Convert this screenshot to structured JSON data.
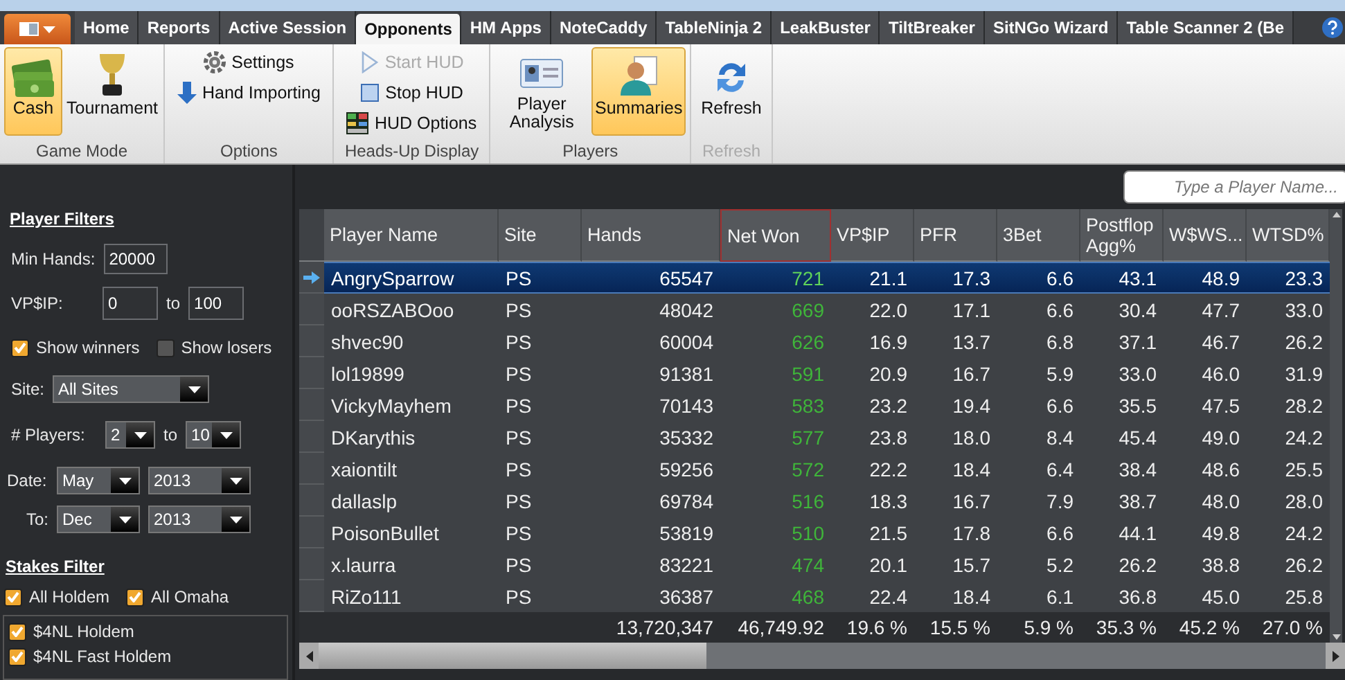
{
  "tabs": [
    {
      "label": "Home",
      "selected": false
    },
    {
      "label": "Reports",
      "selected": false
    },
    {
      "label": "Active Session",
      "selected": false
    },
    {
      "label": "Opponents",
      "selected": true
    },
    {
      "label": "HM Apps",
      "selected": false
    },
    {
      "label": "NoteCaddy",
      "selected": false
    },
    {
      "label": "TableNinja 2",
      "selected": false
    },
    {
      "label": "LeakBuster",
      "selected": false
    },
    {
      "label": "TiltBreaker",
      "selected": false
    },
    {
      "label": "SitNGo Wizard",
      "selected": false
    },
    {
      "label": "Table Scanner 2 (Be",
      "selected": false
    }
  ],
  "ribbon": {
    "groups": [
      {
        "label": "Game Mode",
        "disabled": false,
        "items": [
          {
            "kind": "large",
            "label": "Cash",
            "selected": true
          },
          {
            "kind": "large",
            "label": "Tournament",
            "selected": false
          }
        ]
      },
      {
        "label": "Options",
        "disabled": false,
        "items": [
          {
            "kind": "small",
            "label": "Settings",
            "disabled": false
          },
          {
            "kind": "small",
            "label": "Hand Importing",
            "disabled": false
          }
        ]
      },
      {
        "label": "Heads-Up Display",
        "disabled": false,
        "items": [
          {
            "kind": "small",
            "label": "Start HUD",
            "disabled": true
          },
          {
            "kind": "small",
            "label": "Stop HUD",
            "disabled": false
          },
          {
            "kind": "small",
            "label": "HUD Options",
            "disabled": false
          }
        ]
      },
      {
        "label": "Players",
        "disabled": false,
        "items": [
          {
            "kind": "large",
            "label": "Player Analysis",
            "selected": false
          },
          {
            "kind": "large",
            "label": "Summaries",
            "selected": true
          }
        ]
      },
      {
        "label": "Refresh",
        "disabled": true,
        "items": [
          {
            "kind": "large",
            "label": "Refresh",
            "selected": false
          }
        ]
      }
    ]
  },
  "filters": {
    "title": "Player Filters",
    "min_hands": {
      "label": "Min Hands:",
      "value": "20000"
    },
    "vpip": {
      "label": "VP$IP:",
      "from": "0",
      "to_label": "to",
      "to": "100"
    },
    "show_winners": {
      "label": "Show winners",
      "checked": true
    },
    "show_losers": {
      "label": "Show losers",
      "checked": false
    },
    "site": {
      "label": "Site:",
      "value": "All Sites"
    },
    "players": {
      "label": "# Players:",
      "from": "2",
      "to_label": "to",
      "to": "10"
    },
    "date": {
      "label": "Date:",
      "month": "May",
      "year": "2013"
    },
    "date_to": {
      "label": "To:",
      "month": "Dec",
      "year": "2013"
    }
  },
  "stakes": {
    "title": "Stakes Filter",
    "all_holdem": {
      "label": "All Holdem",
      "checked": true
    },
    "all_omaha": {
      "label": "All Omaha",
      "checked": true
    },
    "items": [
      {
        "label": "$4NL Holdem",
        "checked": true
      },
      {
        "label": "$4NL Fast Holdem",
        "checked": true
      }
    ]
  },
  "search": {
    "placeholder": "Type a Player Name..."
  },
  "table": {
    "columns": [
      {
        "label": "Player Name",
        "kind": "text",
        "sorted": false
      },
      {
        "label": "Site",
        "kind": "text",
        "sorted": false
      },
      {
        "label": "Hands",
        "kind": "number",
        "sorted": false
      },
      {
        "label": "Net Won",
        "kind": "money",
        "sorted": true
      },
      {
        "label": "VP$IP",
        "kind": "number",
        "sorted": false
      },
      {
        "label": "PFR",
        "kind": "number",
        "sorted": false
      },
      {
        "label": "3Bet",
        "kind": "number",
        "sorted": false
      },
      {
        "label": "Postflop Agg%",
        "kind": "number",
        "sorted": false
      },
      {
        "label": "W$WS...",
        "kind": "number",
        "sorted": false
      },
      {
        "label": "WTSD%",
        "kind": "number",
        "sorted": false
      }
    ],
    "rows": [
      {
        "selected": true,
        "cells": [
          "AngrySparrow",
          "PS",
          "65547",
          "721",
          "21.1",
          "17.3",
          "6.6",
          "43.1",
          "48.9",
          "23.3"
        ]
      },
      {
        "selected": false,
        "cells": [
          "ooRSZABOoo",
          "PS",
          "48042",
          "669",
          "22.0",
          "17.1",
          "6.6",
          "30.4",
          "47.7",
          "33.0"
        ]
      },
      {
        "selected": false,
        "cells": [
          "shvec90",
          "PS",
          "60004",
          "626",
          "16.9",
          "13.7",
          "6.8",
          "37.1",
          "46.7",
          "26.2"
        ]
      },
      {
        "selected": false,
        "cells": [
          "lol19899",
          "PS",
          "91381",
          "591",
          "20.9",
          "16.7",
          "5.9",
          "33.0",
          "46.0",
          "31.9"
        ]
      },
      {
        "selected": false,
        "cells": [
          "VickyMayhem",
          "PS",
          "70143",
          "583",
          "23.2",
          "19.4",
          "6.6",
          "35.5",
          "47.5",
          "28.2"
        ]
      },
      {
        "selected": false,
        "cells": [
          "DKarythis",
          "PS",
          "35332",
          "577",
          "23.8",
          "18.0",
          "8.4",
          "45.4",
          "49.0",
          "24.2"
        ]
      },
      {
        "selected": false,
        "cells": [
          "xaiontilt",
          "PS",
          "59256",
          "572",
          "22.2",
          "18.4",
          "6.4",
          "38.4",
          "48.6",
          "25.5"
        ]
      },
      {
        "selected": false,
        "cells": [
          "dallaslp",
          "PS",
          "69784",
          "516",
          "18.3",
          "16.7",
          "7.9",
          "38.7",
          "48.0",
          "28.0"
        ]
      },
      {
        "selected": false,
        "cells": [
          "PoisonBullet",
          "PS",
          "53819",
          "510",
          "21.5",
          "17.8",
          "6.6",
          "44.1",
          "49.8",
          "24.2"
        ]
      },
      {
        "selected": false,
        "cells": [
          "x.laurra",
          "PS",
          "83221",
          "474",
          "20.1",
          "15.7",
          "5.2",
          "26.2",
          "38.8",
          "26.2"
        ]
      },
      {
        "selected": false,
        "cells": [
          "RiZo111",
          "PS",
          "36387",
          "468",
          "22.4",
          "18.4",
          "6.1",
          "36.8",
          "45.0",
          "25.8"
        ]
      }
    ],
    "totals": [
      "13,720,347",
      "46,749.92",
      "19.6 %",
      "15.5 %",
      "5.9 %",
      "35.3 %",
      "45.2 %",
      "27.0 %"
    ]
  }
}
